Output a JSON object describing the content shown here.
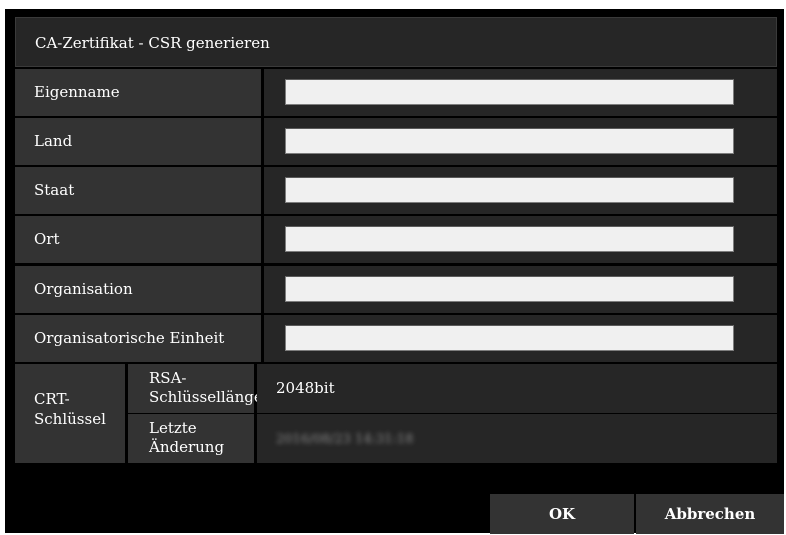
{
  "dialog": {
    "title": "CA-Zertifikat - CSR generieren"
  },
  "fields": [
    {
      "label": "Eigenname",
      "value": ""
    },
    {
      "label": "Land",
      "value": ""
    },
    {
      "label": "Staat",
      "value": ""
    },
    {
      "label": "Ort",
      "value": ""
    },
    {
      "label": "Organisation",
      "value": ""
    },
    {
      "label": "Organisatorische Einheit",
      "value": ""
    }
  ],
  "crt_key": {
    "label": "CRT-\nSchlüssel",
    "key_length_label": "RSA-\nSchlüssellänge",
    "key_length_value": "2048bit",
    "last_change_label": "Letzte\nÄnderung",
    "last_change_value": "2016/08/23 14:31:18"
  },
  "buttons": {
    "ok": "OK",
    "cancel": "Abbrechen"
  }
}
